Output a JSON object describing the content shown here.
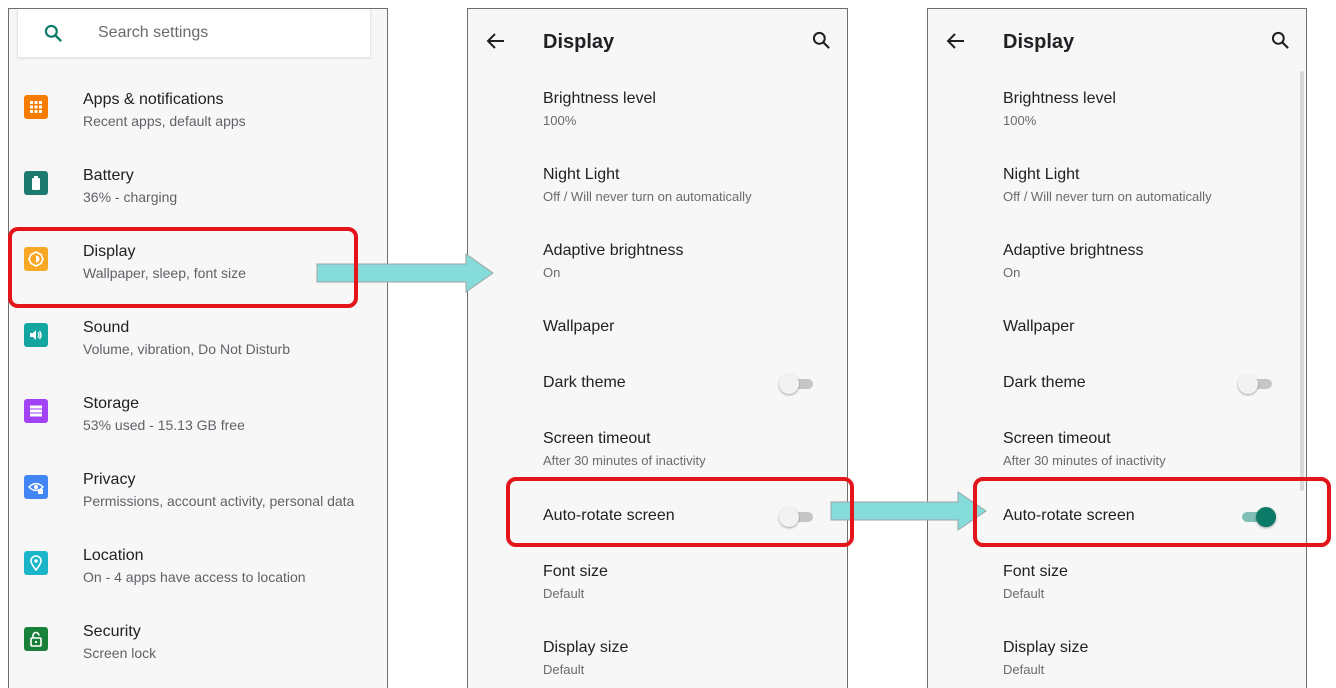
{
  "colors": {
    "highlight": "#e3141a",
    "arrow_fill": "#86dbdb",
    "accent": "#0b7a67"
  },
  "settings": {
    "search_placeholder": "Search settings",
    "items": [
      {
        "title": "Apps & notifications",
        "subtitle": "Recent apps, default apps",
        "icon": "apps-icon",
        "color": "#f57c00"
      },
      {
        "title": "Battery",
        "subtitle": "36% - charging",
        "icon": "battery-icon",
        "color": "#1f7a6e"
      },
      {
        "title": "Display",
        "subtitle": "Wallpaper, sleep, font size",
        "icon": "brightness-icon",
        "color": "#f9a825"
      },
      {
        "title": "Sound",
        "subtitle": "Volume, vibration, Do Not Disturb",
        "icon": "volume-icon",
        "color": "#13a6a0"
      },
      {
        "title": "Storage",
        "subtitle": "53% used - 15.13 GB free",
        "icon": "storage-icon",
        "color": "#a142f4"
      },
      {
        "title": "Privacy",
        "subtitle": "Permissions, account activity, personal data",
        "icon": "privacy-icon",
        "color": "#4285f4"
      },
      {
        "title": "Location",
        "subtitle": "On - 4 apps have access to location",
        "icon": "location-icon",
        "color": "#1ab5c9"
      },
      {
        "title": "Security",
        "subtitle": "Screen lock",
        "icon": "lock-icon",
        "color": "#188038"
      }
    ]
  },
  "display_before": {
    "title": "Display",
    "items": [
      {
        "title": "Brightness level",
        "subtitle": "100%"
      },
      {
        "title": "Night Light",
        "subtitle": "Off / Will never turn on automatically"
      },
      {
        "title": "Adaptive brightness",
        "subtitle": "On"
      },
      {
        "title": "Wallpaper"
      },
      {
        "title": "Dark theme",
        "toggle": false
      },
      {
        "title": "Screen timeout",
        "subtitle": "After 30 minutes of inactivity"
      },
      {
        "title": "Auto-rotate screen",
        "toggle": false
      },
      {
        "title": "Font size",
        "subtitle": "Default"
      },
      {
        "title": "Display size",
        "subtitle": "Default"
      }
    ]
  },
  "display_after": {
    "title": "Display",
    "items": [
      {
        "title": "Brightness level",
        "subtitle": "100%"
      },
      {
        "title": "Night Light",
        "subtitle": "Off / Will never turn on automatically"
      },
      {
        "title": "Adaptive brightness",
        "subtitle": "On"
      },
      {
        "title": "Wallpaper"
      },
      {
        "title": "Dark theme",
        "toggle": false
      },
      {
        "title": "Screen timeout",
        "subtitle": "After 30 minutes of inactivity"
      },
      {
        "title": "Auto-rotate screen",
        "toggle": true
      },
      {
        "title": "Font size",
        "subtitle": "Default"
      },
      {
        "title": "Display size",
        "subtitle": "Default"
      }
    ]
  }
}
